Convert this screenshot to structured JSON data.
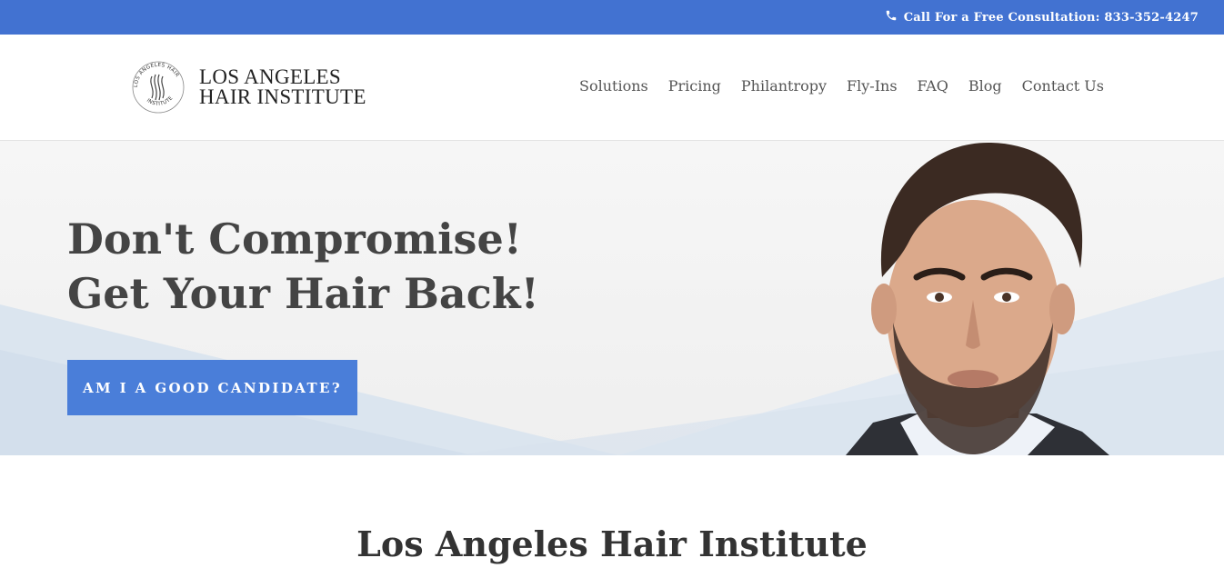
{
  "topbar": {
    "consultation": "Call For a Free Consultation: 833-352-4247",
    "icon": "phone-icon",
    "background": "#4272d1"
  },
  "header": {
    "logo": {
      "ring_text_top": "LOS ANGELES HAIR",
      "ring_text_bottom": "INSTITUTE",
      "line1": "LOS ANGELES",
      "line2": "HAIR INSTITUTE"
    },
    "nav": [
      {
        "label": "Solutions"
      },
      {
        "label": "Pricing"
      },
      {
        "label": "Philantropy"
      },
      {
        "label": "Fly-Ins"
      },
      {
        "label": "FAQ"
      },
      {
        "label": "Blog"
      },
      {
        "label": "Contact Us"
      }
    ]
  },
  "hero": {
    "title_line1": "Don't Compromise!",
    "title_line2": "Get Your Hair Back!",
    "cta_label": "AM I A GOOD CANDIDATE?",
    "cta_color": "#4a7ed9"
  },
  "main": {
    "section_title": "Los Angeles Hair Institute"
  }
}
